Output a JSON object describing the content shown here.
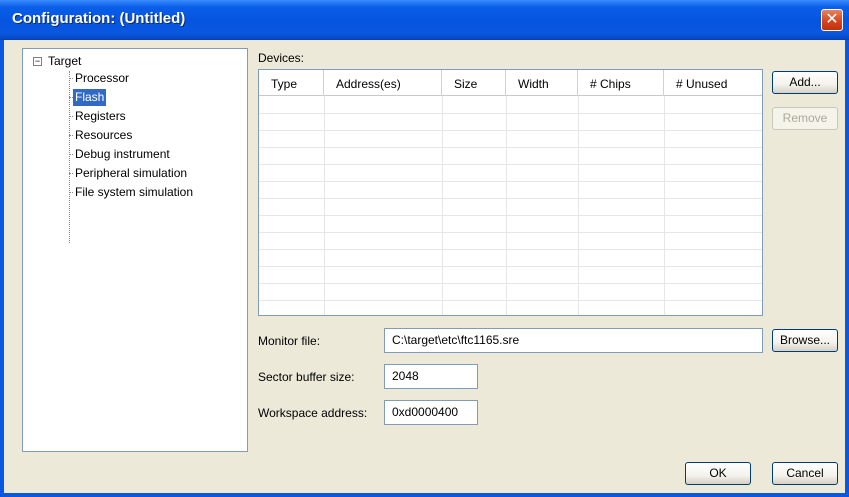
{
  "window": {
    "title": "Configuration: (Untitled)"
  },
  "tree": {
    "root": "Target",
    "items": [
      "Processor",
      "Flash",
      "Registers",
      "Resources",
      "Debug instrument",
      "Peripheral simulation",
      "File system simulation"
    ],
    "selected": "Flash"
  },
  "devices": {
    "label": "Devices:",
    "columns": [
      "Type",
      "Address(es)",
      "Size",
      "Width",
      "# Chips",
      "# Unused"
    ],
    "rows": []
  },
  "buttons": {
    "add": "Add...",
    "remove": "Remove",
    "browse": "Browse...",
    "ok": "OK",
    "cancel": "Cancel"
  },
  "fields": {
    "monitor_file": {
      "label": "Monitor file:",
      "value": "C:\\target\\etc\\ftc1165.sre"
    },
    "sector_buffer_size": {
      "label": "Sector buffer size:",
      "value": "2048"
    },
    "workspace_address": {
      "label": "Workspace address:",
      "value": "0xd0000400"
    }
  },
  "colors": {
    "titlebar": "#0A5EE8",
    "selection": "#316AC5",
    "dialog_bg": "#ECE9D8",
    "close_button": "#D4411D"
  }
}
